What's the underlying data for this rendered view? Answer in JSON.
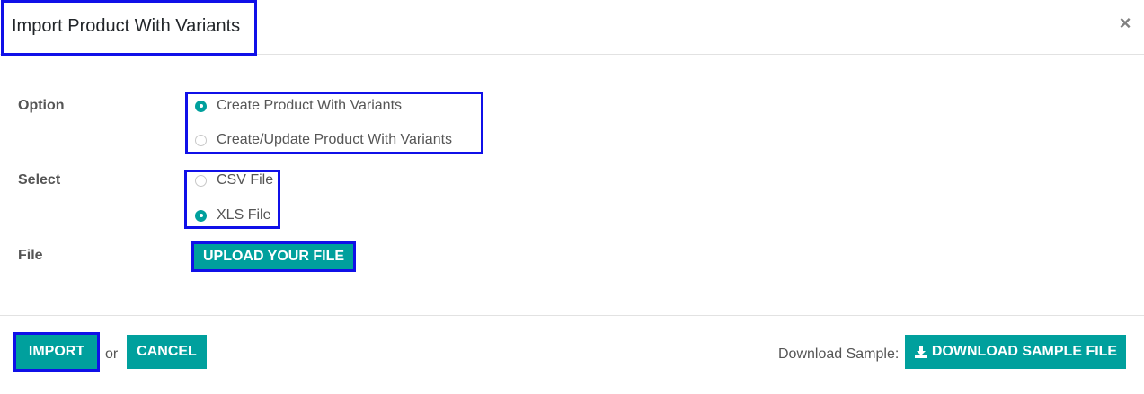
{
  "dialog": {
    "title": "Import Product With Variants",
    "close_symbol": "×"
  },
  "form": {
    "option": {
      "label": "Option",
      "choices": [
        {
          "label": "Create Product With Variants",
          "checked": true
        },
        {
          "label": "Create/Update Product With Variants",
          "checked": false
        }
      ]
    },
    "select": {
      "label": "Select",
      "choices": [
        {
          "label": "CSV File",
          "checked": false
        },
        {
          "label": "XLS File",
          "checked": true
        }
      ]
    },
    "file": {
      "label": "File",
      "upload_label": "UPLOAD YOUR FILE"
    }
  },
  "footer": {
    "import_label": "IMPORT",
    "or_text": "or",
    "cancel_label": "CANCEL",
    "download_text": "Download Sample:",
    "download_button_label": "DOWNLOAD SAMPLE FILE",
    "download_icon": "download-icon"
  },
  "colors": {
    "primary": "#00a09d",
    "highlight_border": "#1010e8"
  }
}
